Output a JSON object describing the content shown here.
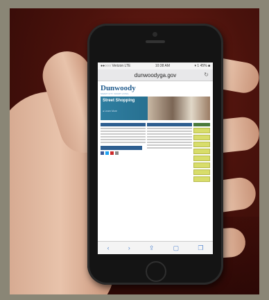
{
  "phone": {
    "status_carrier": "●●○○○ Verizon  LTE",
    "status_time": "10:38 AM",
    "status_battery": "▾ 1 45% ■",
    "url": "dunwoodyga.gov",
    "reload_icon": "↻"
  },
  "website": {
    "logo": "Dunwoody",
    "tagline": "SMART CITY. SMART LIVING.",
    "hero_title": "Street Shopping",
    "hero_link": "● Learn More"
  },
  "toolbar": {
    "back": "‹",
    "forward": "›",
    "share": "⇪",
    "bookmarks": "▢",
    "tabs": "❐"
  },
  "colors": {
    "background_wall": "#4a120c",
    "phone_body": "#141414",
    "site_blue": "#2d5e90",
    "sidebar_button": "#d8dd6a"
  }
}
